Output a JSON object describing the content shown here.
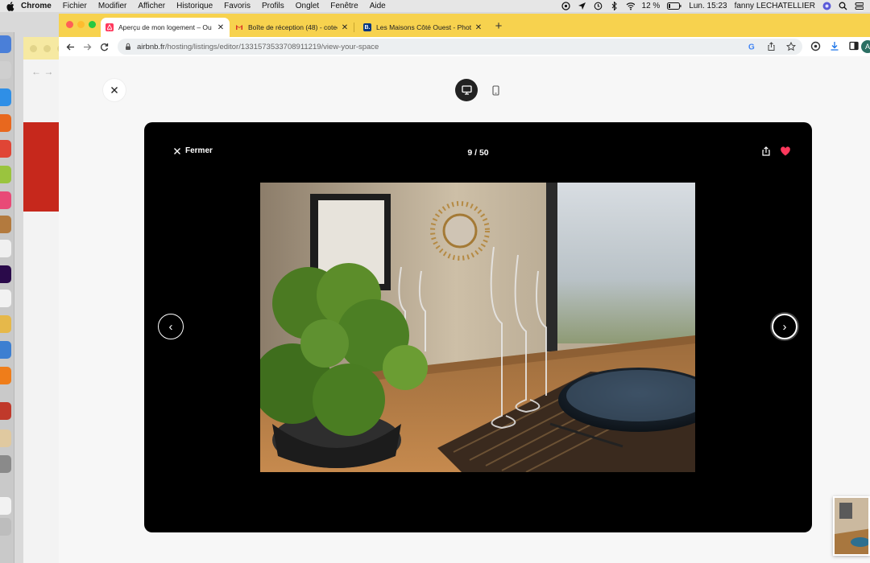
{
  "menubar": {
    "app": "Chrome",
    "items": [
      "Fichier",
      "Modifier",
      "Afficher",
      "Historique",
      "Favoris",
      "Profils",
      "Onglet",
      "Fenêtre",
      "Aide"
    ],
    "battery": "12 %",
    "clock": "Lun. 15:23",
    "user": "fanny LECHATELLIER"
  },
  "tabs": [
    {
      "title": "Aperçu de mon logement – Ou",
      "favicon": "airbnb-icon",
      "active": true
    },
    {
      "title": "Boîte de réception (48) - cotec",
      "favicon": "gmail-icon",
      "active": false
    },
    {
      "title": "Les Maisons Côté Ouest - Phot",
      "favicon": "booking-icon",
      "active": false
    }
  ],
  "toolbar": {
    "url_host": "airbnb.fr",
    "url_path": "/hosting/listings/editor/1331573533708911219/view-your-space",
    "profile_initial": "A"
  },
  "viewer": {
    "close_label": "Fermer",
    "counter": "9 / 50",
    "prev_glyph": "‹",
    "next_glyph": "›"
  },
  "colors": {
    "tabstrip": "#f7d24e",
    "airbnb_red": "#ff385c",
    "viewer_bg": "#000000"
  }
}
